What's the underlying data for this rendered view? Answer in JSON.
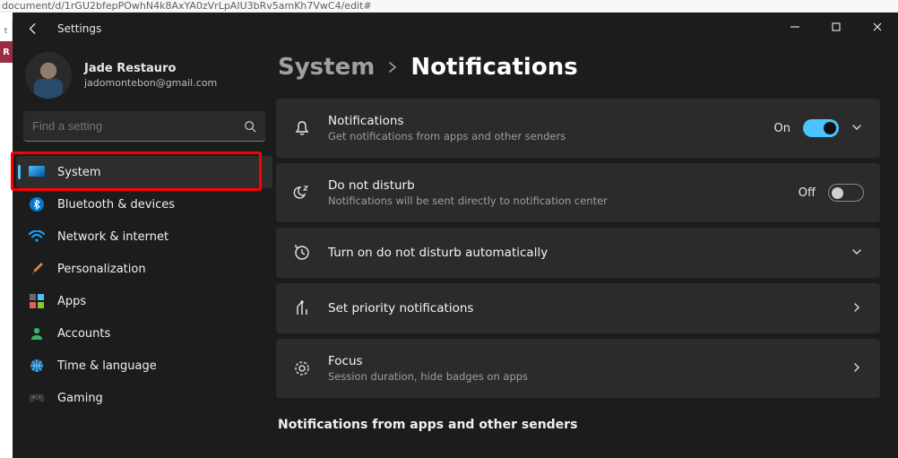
{
  "browser": {
    "url_fragment": "document/d/1rGU2bfepPOwhN4k8AxYA0zVrLpAIU3bRv5amKh7VwC4/edit#"
  },
  "window": {
    "title": "Settings"
  },
  "profile": {
    "name": "Jade Restauro",
    "email": "jadomontebon@gmail.com"
  },
  "search": {
    "placeholder": "Find a setting"
  },
  "sidebar": {
    "items": [
      {
        "label": "System"
      },
      {
        "label": "Bluetooth & devices"
      },
      {
        "label": "Network & internet"
      },
      {
        "label": "Personalization"
      },
      {
        "label": "Apps"
      },
      {
        "label": "Accounts"
      },
      {
        "label": "Time & language"
      },
      {
        "label": "Gaming"
      }
    ],
    "selected_index": 0
  },
  "breadcrumb": {
    "parent": "System",
    "current": "Notifications"
  },
  "cards": {
    "notifications": {
      "title": "Notifications",
      "subtitle": "Get notifications from apps and other senders",
      "state_label": "On",
      "state": true
    },
    "dnd": {
      "title": "Do not disturb",
      "subtitle": "Notifications will be sent directly to notification center",
      "state_label": "Off",
      "state": false
    },
    "dnd_auto": {
      "title": "Turn on do not disturb automatically"
    },
    "priority": {
      "title": "Set priority notifications"
    },
    "focus": {
      "title": "Focus",
      "subtitle": "Session duration, hide badges on apps"
    }
  },
  "section_heading": "Notifications from apps and other senders"
}
